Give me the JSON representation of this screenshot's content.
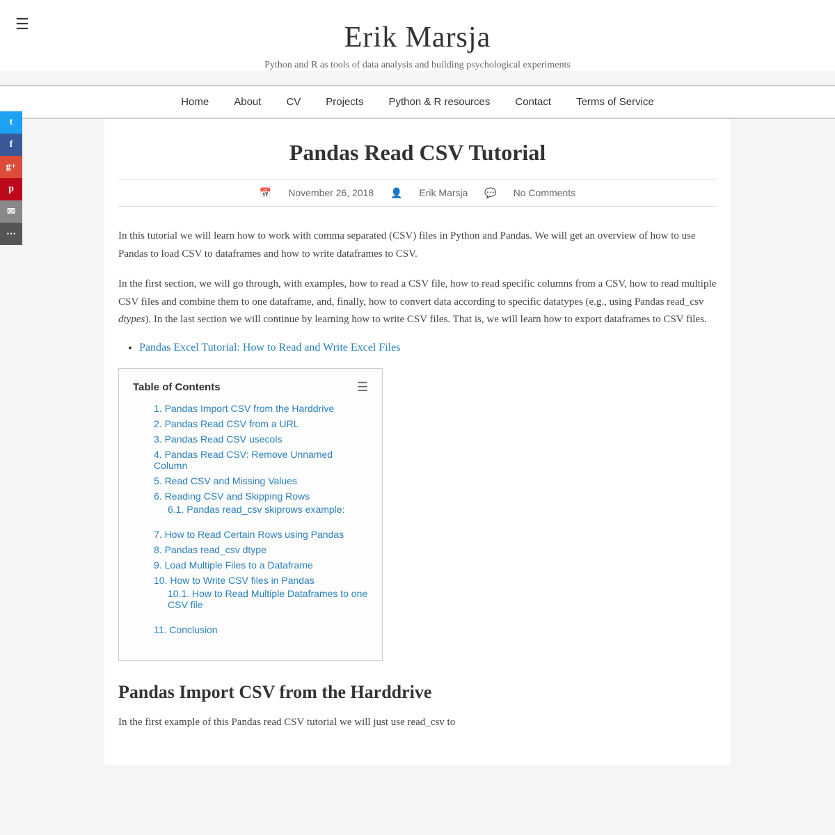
{
  "site": {
    "title": "Erik Marsja",
    "subtitle": "Python and R as tools of data analysis and building psychological experiments",
    "menu_icon": "☰"
  },
  "nav": {
    "items": [
      {
        "label": "Home",
        "href": "#"
      },
      {
        "label": "About",
        "href": "#"
      },
      {
        "label": "CV",
        "href": "#"
      },
      {
        "label": "Projects",
        "href": "#"
      },
      {
        "label": "Python & R resources",
        "href": "#"
      },
      {
        "label": "Contact",
        "href": "#"
      },
      {
        "label": "Terms of Service",
        "href": "#"
      }
    ]
  },
  "social": [
    {
      "name": "twitter",
      "icon": "t",
      "label": "Twitter"
    },
    {
      "name": "facebook",
      "icon": "f",
      "label": "Facebook"
    },
    {
      "name": "google",
      "icon": "g+",
      "label": "Google+"
    },
    {
      "name": "pinterest",
      "icon": "p",
      "label": "Pinterest"
    },
    {
      "name": "email",
      "icon": "✉",
      "label": "Email"
    },
    {
      "name": "more",
      "icon": "⋯",
      "label": "More"
    }
  ],
  "article": {
    "title": "Pandas Read CSV Tutorial",
    "date": "November 26, 2018",
    "author": "Erik Marsja",
    "comments": "No Comments",
    "date_icon": "📅",
    "author_icon": "👤",
    "comments_icon": "💬",
    "intro1": "In this tutorial we will learn how to work with comma separated (CSV) files in Python and Pandas. We will get an overview of how to use Pandas to load CSV to dataframes and how to write dataframes to CSV.",
    "intro2_before": "In the first section, we will go through, with examples, how to read a CSV file, how to read specific columns from a CSV, how to read multiple CSV files and combine them to one dataframe, and, finally, how to convert data according to specific datatypes (e.g., using Pandas read_csv ",
    "intro2_italic": "dtypes",
    "intro2_after": "). In the last section we will continue by learning how to write CSV files. That is, we will learn how to export dataframes to CSV files.",
    "related_link": "Pandas Excel Tutorial: How to Read and Write Excel Files",
    "toc": {
      "title": "Table of Contents",
      "items": [
        {
          "num": "1.",
          "label": "Pandas Import CSV from the Harddrive",
          "sub": []
        },
        {
          "num": "2.",
          "label": "Pandas Read CSV from a URL",
          "sub": []
        },
        {
          "num": "3.",
          "label": "Pandas Read CSV usecols",
          "sub": []
        },
        {
          "num": "4.",
          "label": "Pandas Read CSV: Remove Unnamed Column",
          "sub": []
        },
        {
          "num": "5.",
          "label": "Read CSV and Missing Values",
          "sub": []
        },
        {
          "num": "6.",
          "label": "Reading CSV and Skipping Rows",
          "sub": [
            {
              "num": "6.1.",
              "label": "Pandas read_csv skiprows example:"
            }
          ]
        },
        {
          "num": "7.",
          "label": "How to Read Certain Rows using Pandas",
          "sub": []
        },
        {
          "num": "8.",
          "label": "Pandas read_csv dtype",
          "sub": []
        },
        {
          "num": "9.",
          "label": "Load Multiple Files to a Dataframe",
          "sub": []
        },
        {
          "num": "10.",
          "label": "How to Write CSV files in Pandas",
          "sub": [
            {
              "num": "10.1.",
              "label": "How to Read Multiple Dataframes to one CSV file"
            }
          ]
        },
        {
          "num": "11.",
          "label": "Conclusion",
          "sub": []
        }
      ]
    },
    "section1_title": "Pandas Import CSV from the Harddrive",
    "section1_body": "In the first example of this Pandas read CSV tutorial we will just use read_csv to"
  }
}
